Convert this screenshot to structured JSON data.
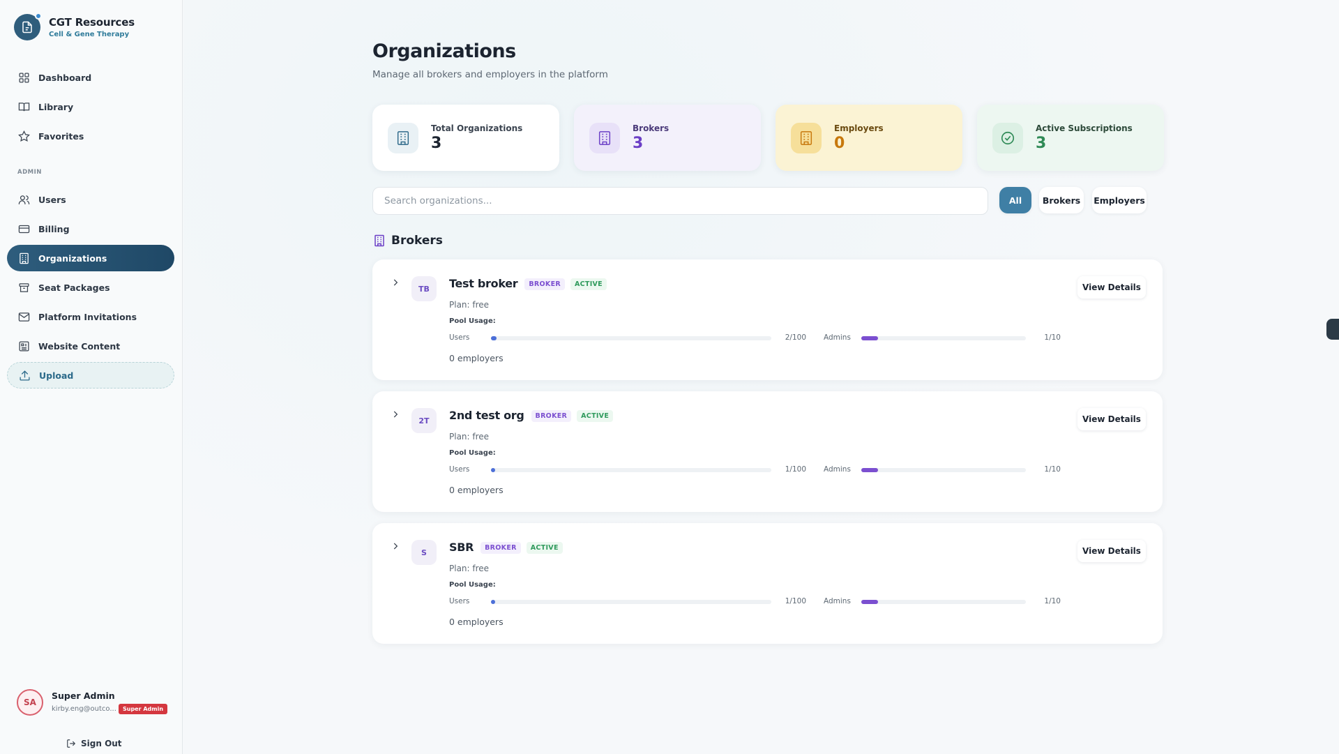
{
  "brand": {
    "title": "CGT Resources",
    "subtitle": "Cell & Gene Therapy"
  },
  "sidebar": {
    "main_items": [
      {
        "label": "Dashboard",
        "icon": "dashboard-icon"
      },
      {
        "label": "Library",
        "icon": "book-icon"
      },
      {
        "label": "Favorites",
        "icon": "star-icon"
      }
    ],
    "section_label": "ADMIN",
    "admin_items": [
      {
        "label": "Users",
        "icon": "users-icon"
      },
      {
        "label": "Billing",
        "icon": "card-icon"
      },
      {
        "label": "Organizations",
        "icon": "building-icon",
        "active": true
      },
      {
        "label": "Seat Packages",
        "icon": "package-icon"
      },
      {
        "label": "Platform Invitations",
        "icon": "mail-icon"
      },
      {
        "label": "Website Content",
        "icon": "content-icon"
      },
      {
        "label": "Upload",
        "icon": "upload-icon"
      }
    ]
  },
  "user": {
    "initials": "SA",
    "name": "Super Admin",
    "email": "kirby.eng@outco...",
    "role_badge": "Super Admin",
    "signout": "Sign Out"
  },
  "page": {
    "title": "Organizations",
    "subtitle": "Manage all brokers and employers in the platform"
  },
  "stats": [
    {
      "label": "Total Organizations",
      "value": "3",
      "color": "#1c2430",
      "bg": "#ffffff",
      "icon_bg": "#e9f1f5",
      "icon_color": "#2f6a8a"
    },
    {
      "label": "Brokers",
      "value": "3",
      "color": "#6b3fc6",
      "bg": "#f3f1fb",
      "icon_bg": "#e8e1f8",
      "icon_color": "#6b3fc6"
    },
    {
      "label": "Employers",
      "value": "0",
      "color": "#c7780c",
      "bg": "#fbf3d4",
      "icon_bg": "#f6df9a",
      "icon_color": "#c7780c"
    },
    {
      "label": "Active Subscriptions",
      "value": "3",
      "color": "#2f8a56",
      "bg": "#edf7f1",
      "icon_bg": "#dcf0e4",
      "icon_color": "#2f8a56"
    }
  ],
  "search": {
    "placeholder": "Search organizations..."
  },
  "filters": {
    "all": "All",
    "brokers": "Brokers",
    "employers": "Employers"
  },
  "brokers_section": {
    "title": "Brokers"
  },
  "organizations": [
    {
      "initials": "TB",
      "name": "Test broker",
      "type_badge": "BROKER",
      "status_badge": "ACTIVE",
      "plan": "Plan: free",
      "pool_label": "Pool Usage:",
      "users_label": "Users",
      "users_value": "2/100",
      "users_fraction": 0.02,
      "admins_label": "Admins",
      "admins_value": "1/10",
      "admins_fraction": 0.1,
      "employers": "0 employers",
      "view": "View Details"
    },
    {
      "initials": "2T",
      "name": "2nd test org",
      "type_badge": "BROKER",
      "status_badge": "ACTIVE",
      "plan": "Plan: free",
      "pool_label": "Pool Usage:",
      "users_label": "Users",
      "users_value": "1/100",
      "users_fraction": 0.01,
      "admins_label": "Admins",
      "admins_value": "1/10",
      "admins_fraction": 0.1,
      "employers": "0 employers",
      "view": "View Details"
    },
    {
      "initials": "S",
      "name": "SBR",
      "type_badge": "BROKER",
      "status_badge": "ACTIVE",
      "plan": "Plan: free",
      "pool_label": "Pool Usage:",
      "users_label": "Users",
      "users_value": "1/100",
      "users_fraction": 0.01,
      "admins_label": "Admins",
      "admins_value": "1/10",
      "admins_fraction": 0.1,
      "employers": "0 employers",
      "view": "View Details"
    }
  ],
  "colors": {
    "accent": "#2e5d7d",
    "users_bar": "#4c6fd8",
    "admins_bar": "#7b4fd0"
  }
}
